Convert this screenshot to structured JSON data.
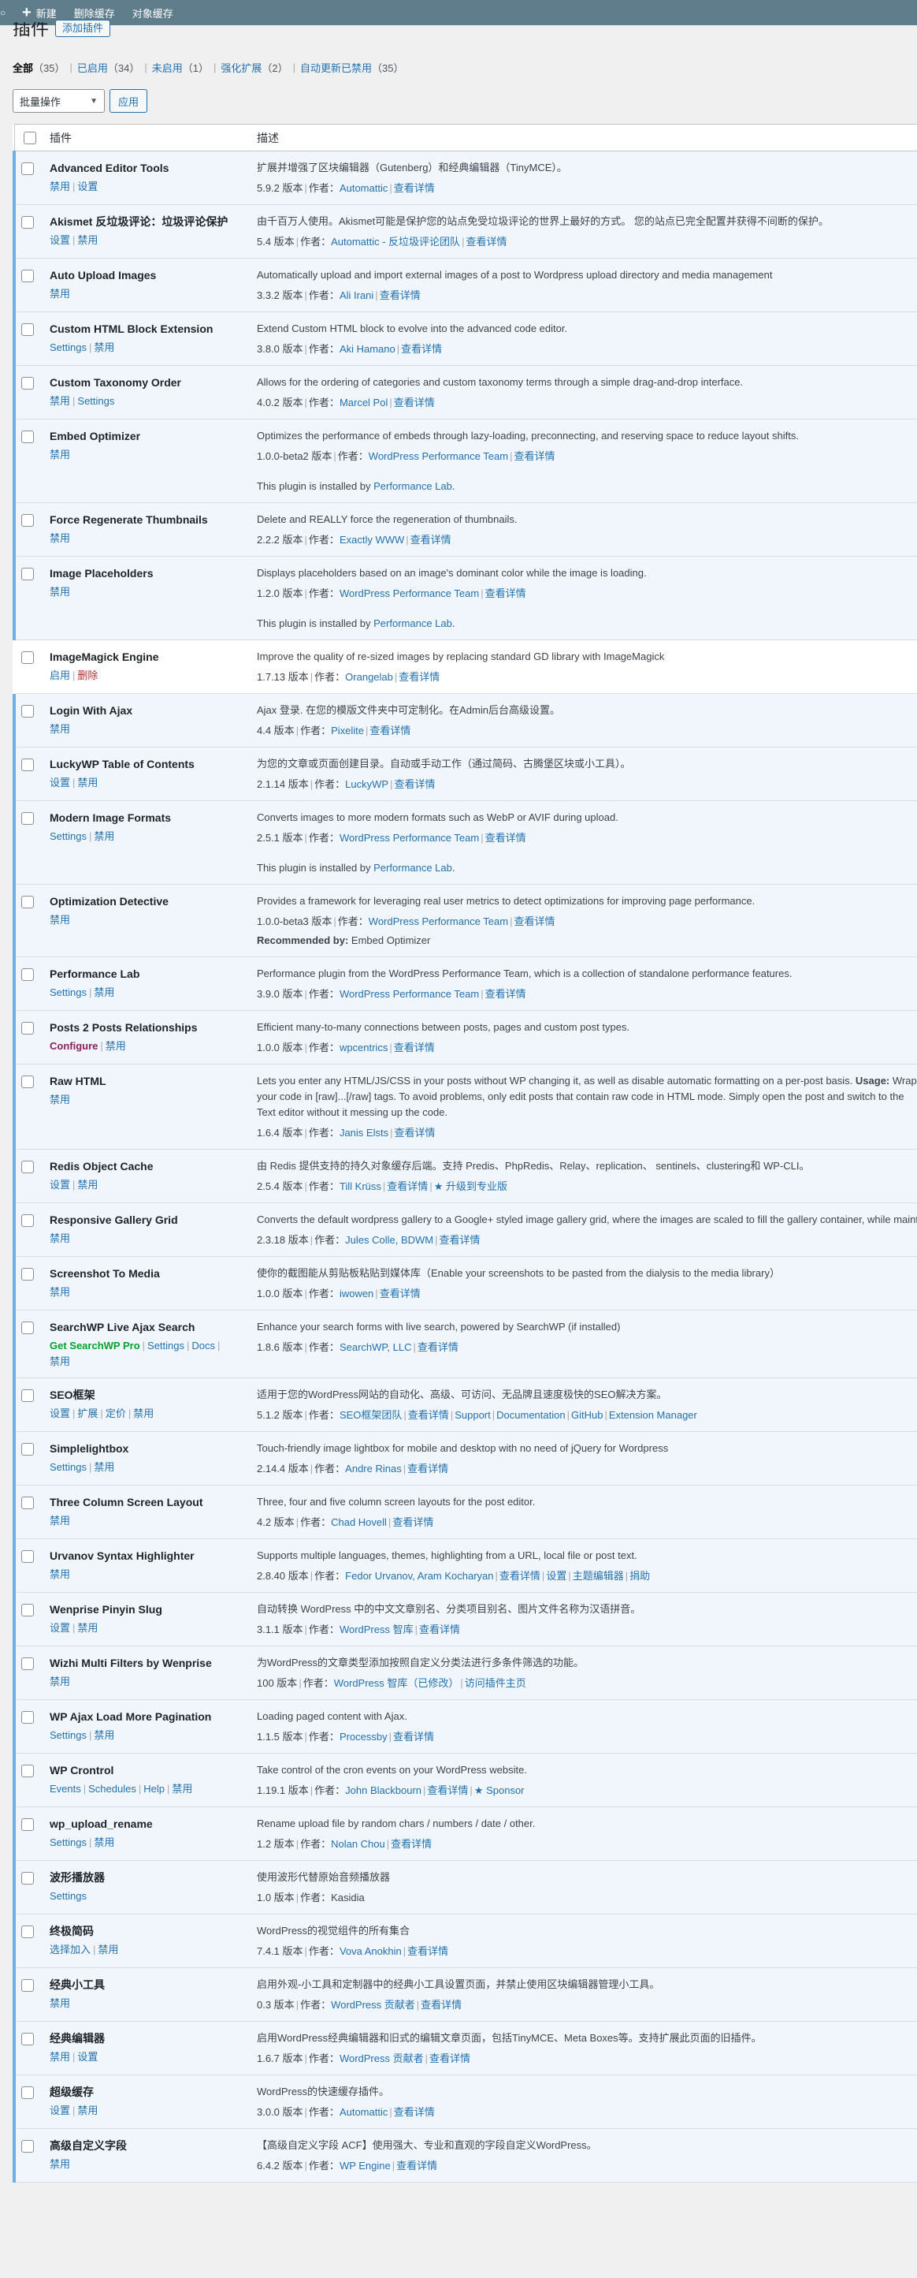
{
  "adminbar": {
    "items": [
      "新建",
      "删除缓存",
      "对象缓存"
    ]
  },
  "page": {
    "title": "插件",
    "add_new": "添加插件"
  },
  "filters": [
    {
      "label": "全部",
      "count": "（35）",
      "current": true
    },
    {
      "label": "已启用",
      "count": "（34）"
    },
    {
      "label": "未启用",
      "count": "（1）"
    },
    {
      "label": "强化扩展",
      "count": "（2）"
    },
    {
      "label": "自动更新已禁用",
      "count": "（35）"
    }
  ],
  "bulk": {
    "select_label": "批量操作",
    "apply_label": "应用"
  },
  "table": {
    "col_plugin": "插件",
    "col_desc": "描述"
  },
  "plugins": [
    {
      "name": "Advanced Editor Tools",
      "actions": [
        [
          "禁用",
          "l"
        ],
        [
          "设置",
          "l"
        ]
      ],
      "desc": "扩展并增强了区块编辑器（Gutenberg）和经典编辑器（TinyMCE）。",
      "version": "5.9.2 版本",
      "by": "作者：",
      "author": "Automattic",
      "links": [
        "查看详情"
      ]
    },
    {
      "name": "Akismet 反垃圾评论：垃圾评论保护",
      "actions": [
        [
          "设置",
          "l"
        ],
        [
          "禁用",
          "l"
        ]
      ],
      "desc": "由千百万人使用。Akismet可能是保护您的站点免受垃圾评论的世界上最好的方式。 您的站点已完全配置并获得不间断的保护。",
      "version": "5.4 版本",
      "by": "作者：",
      "author": "Automattic - 反垃圾评论团队",
      "links": [
        "查看详情"
      ]
    },
    {
      "name": "Auto Upload Images",
      "actions": [
        [
          "禁用",
          "l"
        ]
      ],
      "desc": "Automatically upload and import external images of a post to Wordpress upload directory and media management",
      "version": "3.3.2 版本",
      "by": "作者：",
      "author": "Ali Irani",
      "links": [
        "查看详情"
      ]
    },
    {
      "name": "Custom HTML Block Extension",
      "actions": [
        [
          "Settings",
          "l"
        ],
        [
          "禁用",
          "l"
        ]
      ],
      "desc": "Extend Custom HTML block to evolve into the advanced code editor.",
      "version": "3.8.0 版本",
      "by": "作者：",
      "author": "Aki Hamano",
      "links": [
        "查看详情"
      ]
    },
    {
      "name": "Custom Taxonomy Order",
      "actions": [
        [
          "禁用",
          "l"
        ],
        [
          "Settings",
          "l"
        ]
      ],
      "desc": "Allows for the ordering of categories and custom taxonomy terms through a simple drag-and-drop interface.",
      "version": "4.0.2 版本",
      "by": "作者：",
      "author": "Marcel Pol",
      "links": [
        "查看详情"
      ]
    },
    {
      "name": "Embed Optimizer",
      "actions": [
        [
          "禁用",
          "l"
        ]
      ],
      "desc": "Optimizes the performance of embeds through lazy-loading, preconnecting, and reserving space to reduce layout shifts.",
      "version": "1.0.0-beta2 版本",
      "by": "作者：",
      "author": "WordPress Performance Team",
      "links": [
        "查看详情"
      ],
      "note": "This plugin is installed by ",
      "note_link": "Performance Lab",
      "note_end": "."
    },
    {
      "name": "Force Regenerate Thumbnails",
      "actions": [
        [
          "禁用",
          "l"
        ]
      ],
      "desc": "Delete and REALLY force the regeneration of thumbnails.",
      "version": "2.2.2 版本",
      "by": "作者：",
      "author": "Exactly WWW",
      "links": [
        "查看详情"
      ]
    },
    {
      "name": "Image Placeholders",
      "actions": [
        [
          "禁用",
          "l"
        ]
      ],
      "desc": "Displays placeholders based on an image's dominant color while the image is loading.",
      "version": "1.2.0 版本",
      "by": "作者：",
      "author": "WordPress Performance Team",
      "links": [
        "查看详情"
      ],
      "note": "This plugin is installed by ",
      "note_link": "Performance Lab",
      "note_end": "."
    },
    {
      "name": "ImageMagick Engine",
      "inactive": true,
      "actions": [
        [
          "启用",
          "l"
        ],
        [
          "删除",
          "del"
        ]
      ],
      "desc": "Improve the quality of re-sized images by replacing standard GD library with ImageMagick",
      "version": "1.7.13 版本",
      "by": "作者：",
      "author": "Orangelab",
      "links": [
        "查看详情"
      ]
    },
    {
      "name": "Login With Ajax",
      "actions": [
        [
          "禁用",
          "l"
        ]
      ],
      "desc": "Ajax 登录. 在您的模版文件夹中可定制化。在Admin后台高级设置。",
      "version": "4.4 版本",
      "by": "作者：",
      "author": "Pixelite",
      "links": [
        "查看详情"
      ]
    },
    {
      "name": "LuckyWP Table of Contents",
      "actions": [
        [
          "设置",
          "l"
        ],
        [
          "禁用",
          "l"
        ]
      ],
      "desc": "为您的文章或页面创建目录。自动或手动工作（通过简码、古腾堡区块或小工具）。",
      "version": "2.1.14 版本",
      "by": "作者：",
      "author": "LuckyWP",
      "links": [
        "查看详情"
      ]
    },
    {
      "name": "Modern Image Formats",
      "actions": [
        [
          "Settings",
          "l"
        ],
        [
          "禁用",
          "l"
        ]
      ],
      "desc": "Converts images to more modern formats such as WebP or AVIF during upload.",
      "version": "2.5.1 版本",
      "by": "作者：",
      "author": "WordPress Performance Team",
      "links": [
        "查看详情"
      ],
      "note": "This plugin is installed by ",
      "note_link": "Performance Lab",
      "note_end": "."
    },
    {
      "name": "Optimization Detective",
      "actions": [
        [
          "禁用",
          "l"
        ]
      ],
      "desc": "Provides a framework for leveraging real user metrics to detect optimizations for improving page performance.",
      "version": "1.0.0-beta3 版本",
      "by": "作者：",
      "author": "WordPress Performance Team",
      "links": [
        "查看详情"
      ],
      "rec_label": "Recommended by:",
      "rec_value": " Embed Optimizer"
    },
    {
      "name": "Performance Lab",
      "actions": [
        [
          "Settings",
          "l"
        ],
        [
          "禁用",
          "l"
        ]
      ],
      "desc": "Performance plugin from the WordPress Performance Team, which is a collection of standalone performance features.",
      "version": "3.9.0 版本",
      "by": "作者：",
      "author": "WordPress Performance Team",
      "links": [
        "查看详情"
      ]
    },
    {
      "name": "Posts 2 Posts Relationships",
      "actions": [
        [
          "Configure",
          "cfg"
        ],
        [
          "禁用",
          "l"
        ]
      ],
      "desc": "Efficient many-to-many connections between posts, pages and custom post types.",
      "version": "1.0.0 版本",
      "by": "作者：",
      "author": "wpcentrics",
      "links": [
        "查看详情"
      ]
    },
    {
      "name": "Raw HTML",
      "actions": [
        [
          "禁用",
          "l"
        ]
      ],
      "desc": "Lets you enter any HTML/JS/CSS in your posts without WP changing it, as well as disable automatic formatting on a per-post basis.",
      "desc_bold": " Usage:",
      "desc_tail": " Wrap your code in [raw]...[/raw] tags. To avoid problems, only edit posts that contain raw code in HTML mode. Simply open the post and switch to the Text editor without it messing up the code.",
      "wrap": true,
      "version": "1.6.4 版本",
      "by": "作者：",
      "author": "Janis Elsts",
      "links": [
        "查看详情"
      ]
    },
    {
      "name": "Redis Object Cache",
      "actions": [
        [
          "设置",
          "l"
        ],
        [
          "禁用",
          "l"
        ]
      ],
      "desc": "由 Redis 提供支持的持久对象缓存后端。支持 Predis、PhpRedis、Relay、replication、 sentinels、clustering和 WP-CLI。",
      "version": "2.5.4 版本",
      "by": "作者：",
      "author": "Till Krüss",
      "links": [
        "查看详情"
      ],
      "extra_star": "升级到专业版"
    },
    {
      "name": "Responsive Gallery Grid",
      "actions": [
        [
          "禁用",
          "l"
        ]
      ],
      "desc": "Converts the default wordpress gallery to a Google+ styled image gallery grid, where the images are scaled to fill the gallery container, while maintaining image aspect ratio.",
      "version": "2.3.18 版本",
      "by": "作者：",
      "author": "Jules Colle, BDWM",
      "links": [
        "查看详情"
      ]
    },
    {
      "name": "Screenshot To Media",
      "actions": [
        [
          "禁用",
          "l"
        ]
      ],
      "desc": "使你的截图能从剪贴板粘贴到媒体库（Enable your screenshots to be pasted from the dialysis to the media library）",
      "version": "1.0.0 版本",
      "by": "作者：",
      "author": "iwowen",
      "links": [
        "查看详情"
      ]
    },
    {
      "name": "SearchWP Live Ajax Search",
      "actions": [
        [
          "Get SearchWP Pro",
          "pro"
        ],
        [
          "Settings",
          "l"
        ],
        [
          "Docs",
          "l"
        ],
        [
          "禁用",
          "l"
        ]
      ],
      "wrap_actions": true,
      "desc": "Enhance your search forms with live search, powered by SearchWP (if installed)",
      "version": "1.8.6 版本",
      "by": "作者：",
      "author": "SearchWP, LLC",
      "links": [
        "查看详情"
      ]
    },
    {
      "name": "SEO框架",
      "actions": [
        [
          "设置",
          "l"
        ],
        [
          "扩展",
          "l"
        ],
        [
          "定价",
          "l"
        ],
        [
          "禁用",
          "l"
        ]
      ],
      "desc": "适用于您的WordPress网站的自动化、高级、可访问、无品牌且速度极快的SEO解决方案。",
      "version": "5.1.2 版本",
      "by": "作者：",
      "author": "SEO框架团队",
      "links": [
        "查看详情",
        "Support",
        "Documentation",
        "GitHub",
        "Extension Manager"
      ]
    },
    {
      "name": "Simplelightbox",
      "actions": [
        [
          "Settings",
          "l"
        ],
        [
          "禁用",
          "l"
        ]
      ],
      "desc": "Touch-friendly image lightbox for mobile and desktop with no need of jQuery for Wordpress",
      "version": "2.14.4 版本",
      "by": "作者：",
      "author": "Andre Rinas",
      "links": [
        "查看详情"
      ]
    },
    {
      "name": "Three Column Screen Layout",
      "actions": [
        [
          "禁用",
          "l"
        ]
      ],
      "desc": "Three, four and five column screen layouts for the post editor.",
      "version": "4.2 版本",
      "by": "作者：",
      "author": "Chad Hovell",
      "links": [
        "查看详情"
      ]
    },
    {
      "name": "Urvanov Syntax Highlighter",
      "actions": [
        [
          "禁用",
          "l"
        ]
      ],
      "desc": "Supports multiple languages, themes, highlighting from a URL, local file or post text.",
      "version": "2.8.40 版本",
      "by": "作者：",
      "author": "Fedor Urvanov, Aram Kocharyan",
      "links": [
        "查看详情",
        "设置",
        "主题编辑器",
        "捐助"
      ]
    },
    {
      "name": "Wenprise Pinyin Slug",
      "actions": [
        [
          "设置",
          "l"
        ],
        [
          "禁用",
          "l"
        ]
      ],
      "desc": "自动转换 WordPress 中的中文文章别名、分类项目别名、图片文件名称为汉语拼音。",
      "version": "3.1.1 版本",
      "by": "作者：",
      "author": "WordPress 智库",
      "links": [
        "查看详情"
      ]
    },
    {
      "name": "Wizhi Multi Filters by Wenprise",
      "actions": [
        [
          "禁用",
          "l"
        ]
      ],
      "desc": "为WordPress的文章类型添加按照自定义分类法进行多条件筛选的功能。",
      "version": "100 版本",
      "by": "作者：",
      "author": "WordPress 智库（已修改）",
      "links": [
        "访问插件主页"
      ]
    },
    {
      "name": "WP Ajax Load More Pagination",
      "actions": [
        [
          "Settings",
          "l"
        ],
        [
          "禁用",
          "l"
        ]
      ],
      "desc": "Loading paged content with Ajax.",
      "version": "1.1.5 版本",
      "by": "作者：",
      "author": "Processby",
      "links": [
        "查看详情"
      ]
    },
    {
      "name": "WP Crontrol",
      "actions": [
        [
          "Events",
          "l"
        ],
        [
          "Schedules",
          "l"
        ],
        [
          "Help",
          "l"
        ],
        [
          "禁用",
          "l"
        ]
      ],
      "desc": "Take control of the cron events on your WordPress website.",
      "version": "1.19.1 版本",
      "by": "作者：",
      "author": "John Blackbourn",
      "links": [
        "查看详情"
      ],
      "extra_star": "Sponsor"
    },
    {
      "name": "wp_upload_rename",
      "actions": [
        [
          "Settings",
          "l"
        ],
        [
          "禁用",
          "l"
        ]
      ],
      "desc": "Rename upload file by random chars / numbers / date / other.",
      "version": "1.2 版本",
      "by": "作者：",
      "author": "Nolan Chou",
      "links": [
        "查看详情"
      ]
    },
    {
      "name": "波形播放器",
      "actions": [
        [
          "Settings",
          "l"
        ]
      ],
      "desc": "使用波形代替原始音频播放器",
      "version": "1.0 版本",
      "by": "作者：",
      "author_plain": "Kasidia",
      "links": []
    },
    {
      "name": "终极简码",
      "actions": [
        [
          "选择加入",
          "l"
        ],
        [
          "禁用",
          "l"
        ]
      ],
      "desc": "WordPress的视觉组件的所有集合",
      "version": "7.4.1 版本",
      "by": "作者：",
      "author": "Vova Anokhin",
      "links": [
        "查看详情"
      ]
    },
    {
      "name": "经典小工具",
      "actions": [
        [
          "禁用",
          "l"
        ]
      ],
      "desc": "启用外观-小工具和定制器中的经典小工具设置页面，并禁止使用区块编辑器管理小工具。",
      "version": "0.3 版本",
      "by": "作者：",
      "author": "WordPress 贡献者",
      "links": [
        "查看详情"
      ]
    },
    {
      "name": "经典编辑器",
      "actions": [
        [
          "禁用",
          "l"
        ],
        [
          "设置",
          "l"
        ]
      ],
      "desc": "启用WordPress经典编辑器和旧式的编辑文章页面，包括TinyMCE、Meta Boxes等。支持扩展此页面的旧插件。",
      "version": "1.6.7 版本",
      "by": "作者：",
      "author": "WordPress 贡献者",
      "links": [
        "查看详情"
      ]
    },
    {
      "name": "超级缓存",
      "actions": [
        [
          "设置",
          "l"
        ],
        [
          "禁用",
          "l"
        ]
      ],
      "desc": "WordPress的快速缓存插件。",
      "version": "3.0.0 版本",
      "by": "作者：",
      "author": "Automattic",
      "links": [
        "查看详情"
      ]
    },
    {
      "name": "高级自定义字段",
      "actions": [
        [
          "禁用",
          "l"
        ]
      ],
      "desc": "【高级自定义字段 ACF】使用强大、专业和直观的字段自定义WordPress。",
      "version": "6.4.2 版本",
      "by": "作者：",
      "author": "WP Engine",
      "links": [
        "查看详情"
      ]
    }
  ]
}
